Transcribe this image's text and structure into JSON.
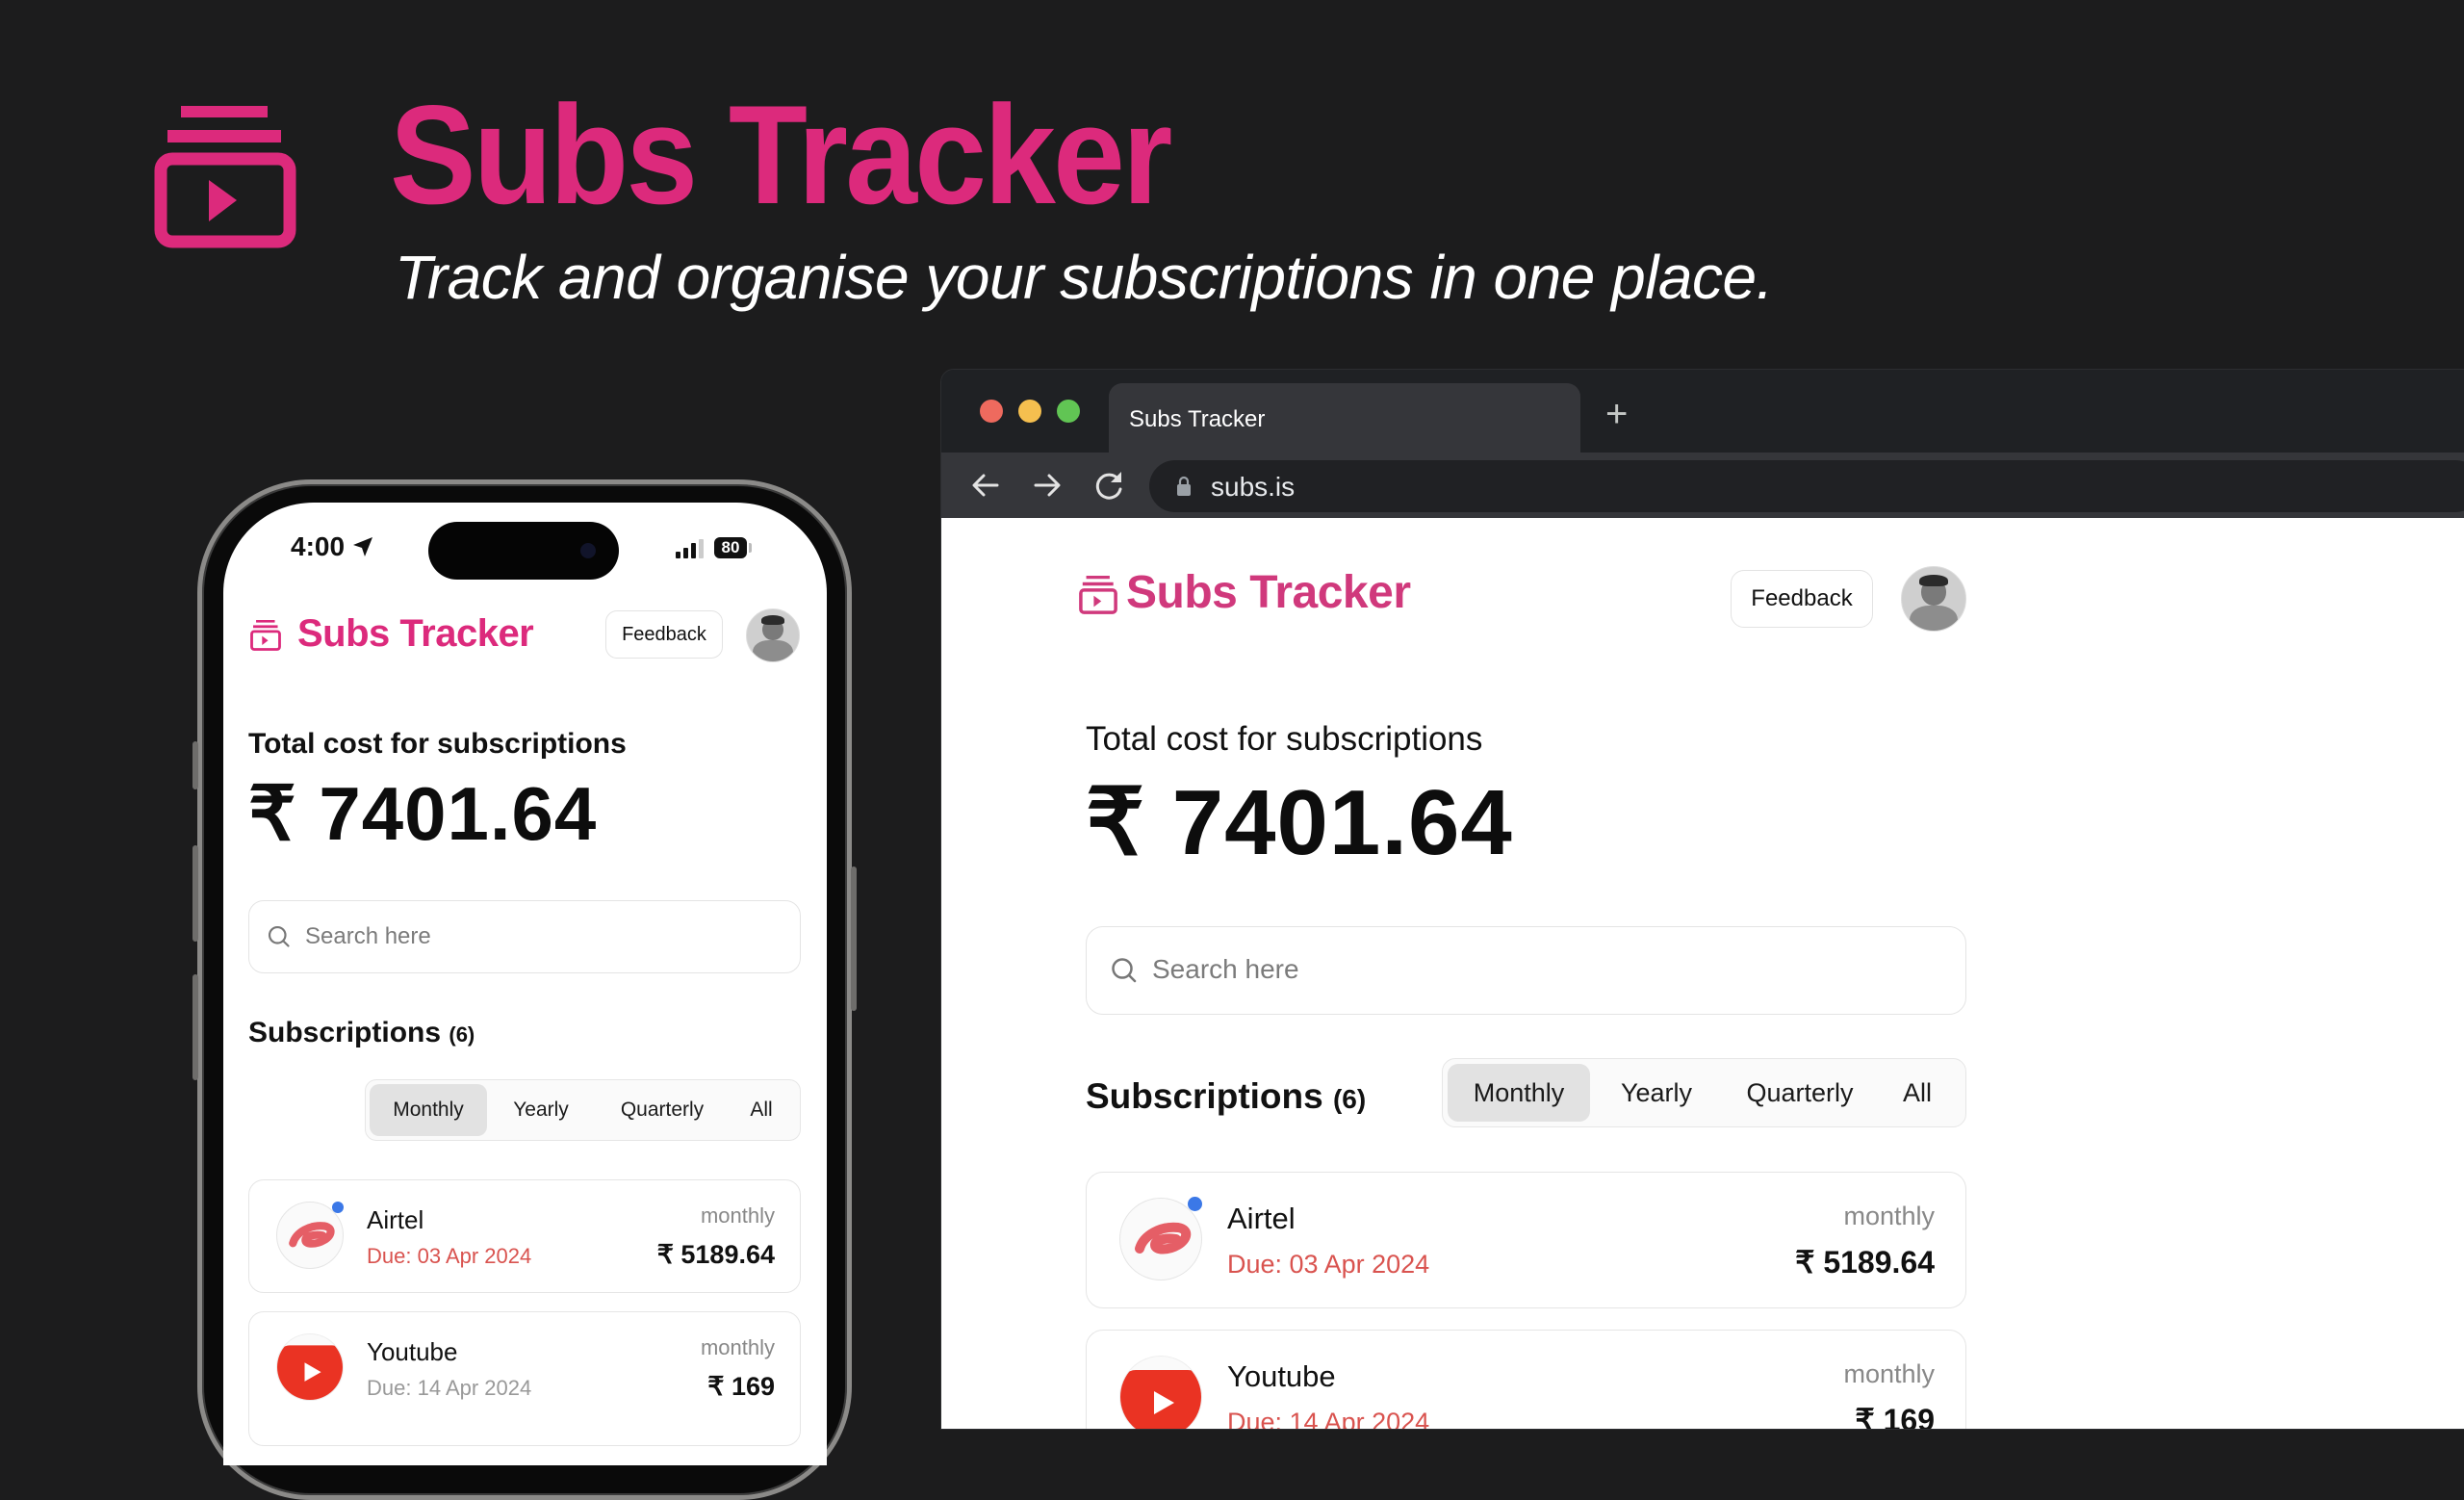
{
  "hero": {
    "title": "Subs Tracker",
    "tagline": "Track and organise your subscriptions in one place.",
    "accent_color": "#dc2a7c"
  },
  "browser": {
    "tab_title": "Subs Tracker",
    "new_tab_icon": "+",
    "url": "subs.is"
  },
  "app": {
    "title": "Subs Tracker",
    "feedback_label": "Feedback",
    "total_label": "Total cost for subscriptions",
    "currency_symbol": "₹",
    "total_amount": "7401.64",
    "search_placeholder": "Search here",
    "subscriptions_label": "Subscriptions",
    "subscriptions_count": "(6)",
    "filters": [
      {
        "label": "Monthly",
        "active": true
      },
      {
        "label": "Yearly",
        "active": false
      },
      {
        "label": "Quarterly",
        "active": false
      },
      {
        "label": "All",
        "active": false
      }
    ],
    "subscriptions": [
      {
        "name": "Airtel",
        "due": "Due: 03 Apr 2024",
        "cycle": "monthly",
        "price": "₹ 5189.64",
        "logo": "airtel-logo",
        "unread": true
      },
      {
        "name": "Youtube",
        "due": "Due: 14 Apr 2024",
        "cycle": "monthly",
        "price": "₹ 169",
        "logo": "youtube-logo",
        "unread": false
      }
    ]
  },
  "phone": {
    "status_time": "4:00",
    "battery": "80"
  }
}
